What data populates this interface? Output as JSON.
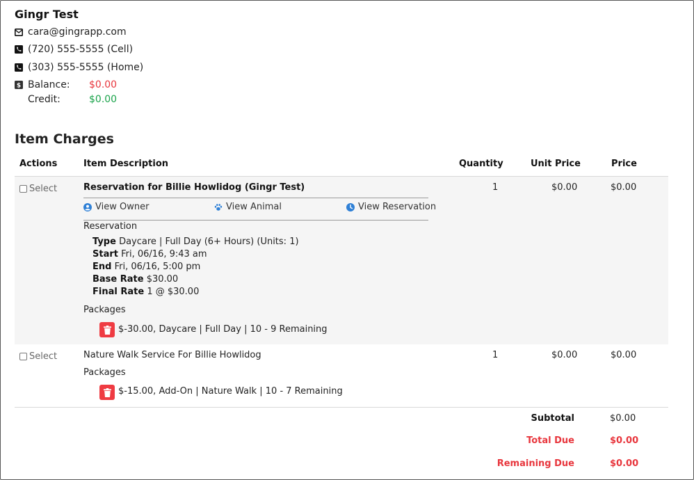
{
  "customer": {
    "name": "Gingr Test",
    "email": "cara@gingrapp.com",
    "phone_cell": "(720) 555-5555 (Cell)",
    "phone_home": "(303) 555-5555 (Home)",
    "balance_label": "Balance:",
    "balance_value": "$0.00",
    "credit_label": "Credit:",
    "credit_value": "$0.00"
  },
  "section_title": "Item Charges",
  "table": {
    "headers": {
      "actions": "Actions",
      "description": "Item Description",
      "quantity": "Quantity",
      "unit_price": "Unit Price",
      "price": "Price"
    },
    "rows": [
      {
        "select_label": "Select",
        "title": "Reservation for Billie Howlidog (Gingr Test)",
        "quantity": "1",
        "unit_price": "$0.00",
        "price": "$0.00",
        "links": {
          "view_owner": "View Owner",
          "view_animal": "View Animal",
          "view_reservation": "View Reservation"
        },
        "reservation_label": "Reservation",
        "details": [
          {
            "label": "Type",
            "value": "Daycare | Full Day (6+ Hours) (Units: 1)"
          },
          {
            "label": "Start",
            "value": "Fri, 06/16, 9:43 am"
          },
          {
            "label": "End",
            "value": "Fri, 06/16, 5:00 pm"
          },
          {
            "label": "Base Rate",
            "value": "$30.00"
          },
          {
            "label": "Final Rate",
            "value": "1 @ $30.00"
          }
        ],
        "packages_label": "Packages",
        "package": "$-30.00, Daycare | Full Day | 10 - 9 Remaining"
      },
      {
        "select_label": "Select",
        "title": "Nature Walk Service For Billie Howlidog",
        "quantity": "1",
        "unit_price": "$0.00",
        "price": "$0.00",
        "packages_label": "Packages",
        "package": "$-15.00, Add-On | Nature Walk | 10 - 7 Remaining"
      }
    ]
  },
  "totals": {
    "subtotal_label": "Subtotal",
    "subtotal_value": "$0.00",
    "total_due_label": "Total Due",
    "total_due_value": "$0.00",
    "remaining_due_label": "Remaining Due",
    "remaining_due_value": "$0.00"
  },
  "colors": {
    "alert_red": "#e8363d",
    "credit_green": "#1aa34a",
    "link_blue": "#2f80d6",
    "trash_red": "#ef3b42"
  }
}
